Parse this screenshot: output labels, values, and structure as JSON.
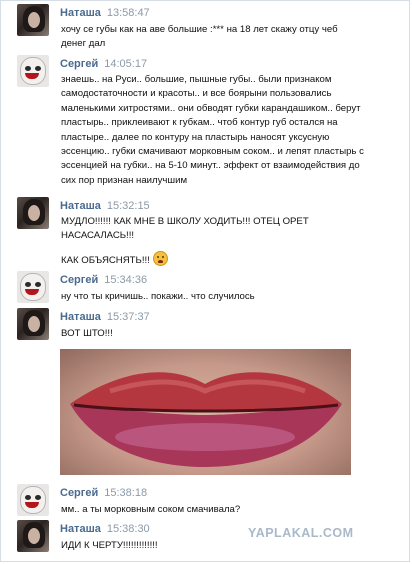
{
  "messages": [
    {
      "name": "Наташа",
      "time": "13:58:47",
      "avatar": "natasha",
      "text": "хочу се губы как на аве большие :*** на 18 лет скажу отцу чеб\nденег дал"
    },
    {
      "name": "Сергей",
      "time": "14:05:17",
      "avatar": "sergey",
      "text": "знаешь.. на Руси.. большие, пышные губы.. были признаком\nсамодостаточности и красоты.. и все боярыни пользовались\nмаленькими хитростями.. они обводят губки карандашиком.. берут\nпластырь.. приклеивают к губкам.. чтоб контур губ остался на\nпластыре.. далее по контуру на пластырь наносят уксусную\nэссенцию.. губки смачивают морковным соком.. и лепят пластырь с\nэссенцией на губки.. на 5-10 минут.. эффект от взаимодействия до\nсих пор признан наилучшим"
    },
    {
      "name": "Наташа",
      "time": "15:32:15",
      "avatar": "natasha",
      "text": "МУДЛО!!!!!! КАК МНЕ В ШКОЛУ ХОДИТЬ!!! ОТЕЦ ОРЕТ\nНАСАСАЛАСЬ!!!",
      "text2": "КАК ОБЪЯСНЯТЬ!!!"
    },
    {
      "name": "Сергей",
      "time": "15:34:36",
      "avatar": "sergey",
      "text": "ну что ты кричишь.. покажи.. что случилось"
    },
    {
      "name": "Наташа",
      "time": "15:37:37",
      "avatar": "natasha",
      "text": "ВОТ ШТО!!!"
    },
    {
      "name": "Сергей",
      "time": "15:38:18",
      "avatar": "sergey",
      "text": "мм.. а ты морковным соком смачивала?"
    },
    {
      "name": "Наташа",
      "time": "15:38:30",
      "avatar": "natasha",
      "text": "ИДИ К ЧЕРТУ!!!!!!!!!!!!!"
    }
  ],
  "icons": {
    "avatar_natasha": "woman-portrait-avatar",
    "avatar_sergey": "clown-face-avatar",
    "emoji": "crying-face-emoji"
  },
  "colors": {
    "name": "#4a6a8f",
    "time": "#8c9aa9",
    "watermark": "#a9b9ca"
  },
  "watermark": "YAPLAKAL.COM"
}
